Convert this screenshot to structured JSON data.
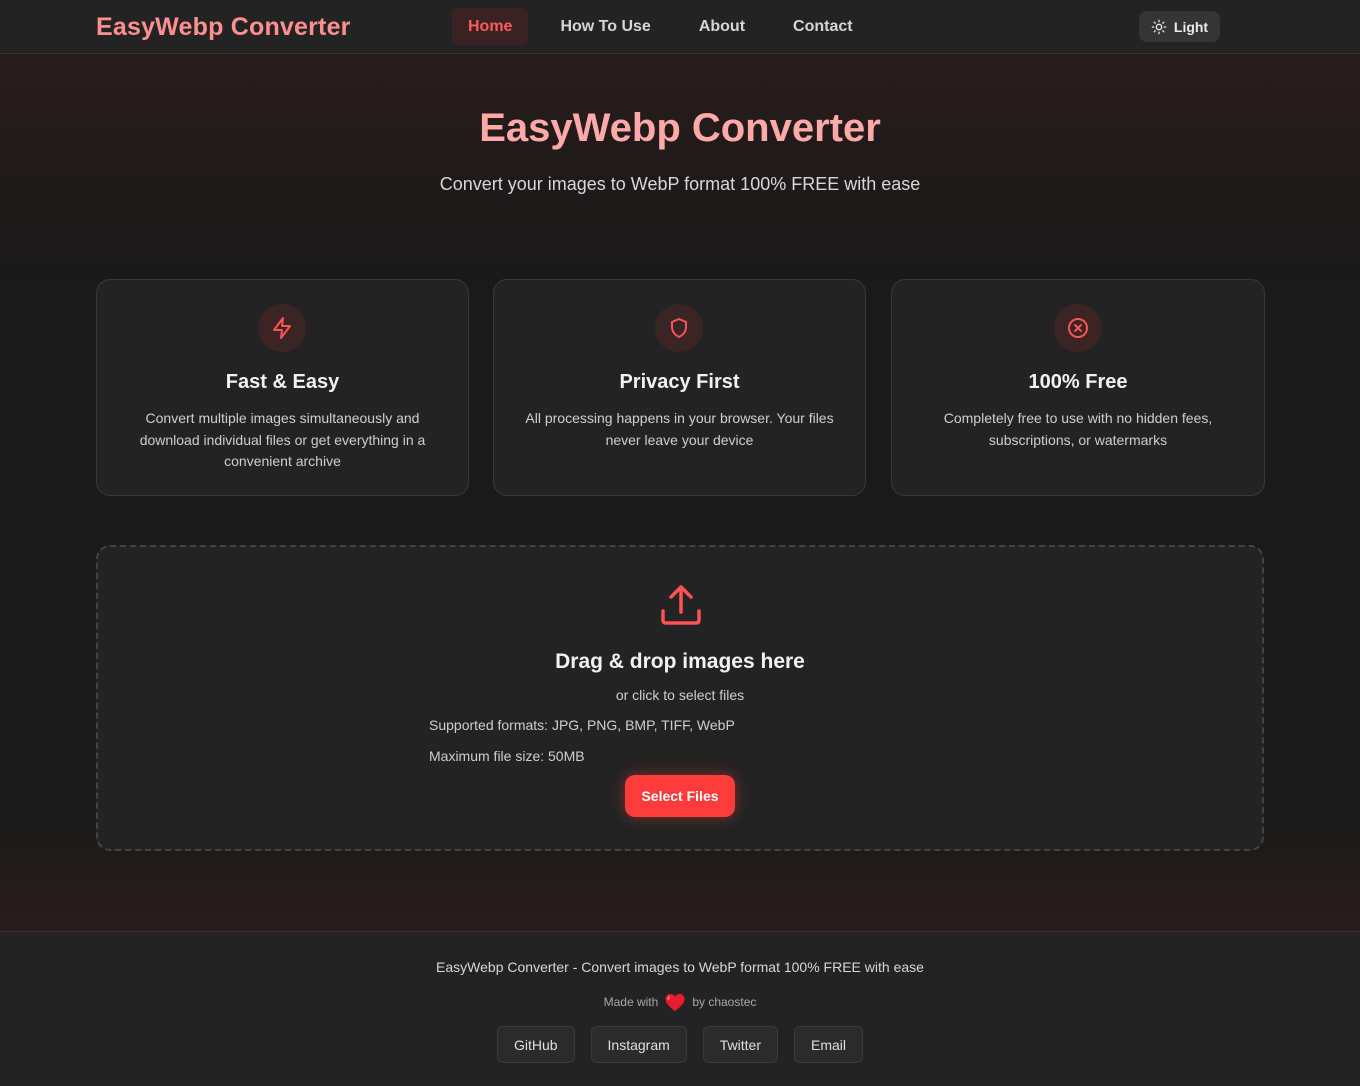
{
  "nav": {
    "brand": "EasyWebp Converter",
    "links": [
      {
        "label": "Home",
        "active": true
      },
      {
        "label": "How To Use",
        "active": false
      },
      {
        "label": "About",
        "active": false
      },
      {
        "label": "Contact",
        "active": false
      }
    ],
    "theme_toggle_label": "Light",
    "theme_icon": "sun-icon"
  },
  "hero": {
    "title": "EasyWebp Converter",
    "subtitle": "Convert your images to WebP format 100% FREE with ease"
  },
  "features": [
    {
      "icon": "lightning-icon",
      "title": "Fast & Easy",
      "text": "Convert multiple images simultaneously and download individual files or get everything in a convenient archive"
    },
    {
      "icon": "shield-icon",
      "title": "Privacy First",
      "text": "All processing happens in your browser. Your files never leave your device"
    },
    {
      "icon": "circle-x-icon",
      "title": "100% Free",
      "text": "Completely free to use with no hidden fees, subscriptions, or watermarks"
    }
  ],
  "dropzone": {
    "icon": "upload-icon",
    "title": "Drag & drop images here",
    "subtitle": "or click to select files",
    "formats": "Supported formats: JPG, PNG, BMP, TIFF, WebP",
    "max_size": "Maximum file size: 50MB",
    "button_label": "Select Files"
  },
  "footer": {
    "tagline": "EasyWebp Converter - Convert images to WebP format 100% FREE with ease",
    "made_with": "Made with",
    "by": "by chaostec",
    "links": [
      "GitHub",
      "Instagram",
      "Twitter",
      "Email"
    ]
  },
  "colors": {
    "accent": "#ff3b3b",
    "brand": "#ff8f8f",
    "background": "#1a1a1a",
    "surface": "#232323"
  }
}
